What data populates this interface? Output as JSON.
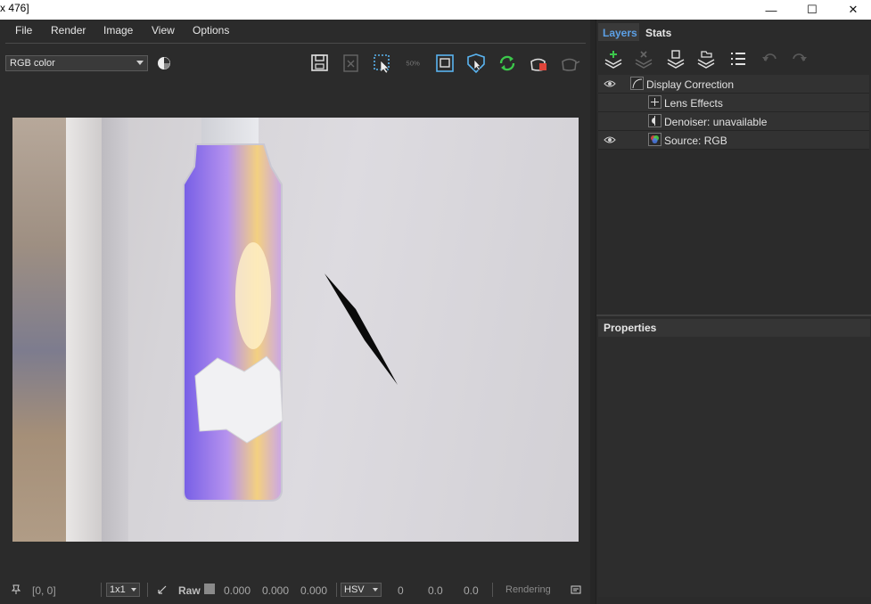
{
  "window": {
    "title_fragment": "x 476]",
    "controls": {
      "minimize": "—",
      "maximize": "☐",
      "close": "✕"
    }
  },
  "menu": [
    "File",
    "Render",
    "Image",
    "View",
    "Options"
  ],
  "toolbar": {
    "channel_select": "RGB color",
    "zoom_label": "50%",
    "icons": [
      "save-icon",
      "clear-icon",
      "region-select-icon",
      "zoom-icon",
      "region-render-icon",
      "track-mouse-icon",
      "refresh-icon",
      "render-last-icon",
      "teapot-icon"
    ]
  },
  "status": {
    "coords": "[0, 0]",
    "sampling": "1x1",
    "raw_label": "Raw",
    "rgb_values": [
      "0.000",
      "0.000",
      "0.000"
    ],
    "color_mode": "HSV",
    "hsv_values": [
      "0",
      "0.0",
      "0.0"
    ],
    "state": "Rendering"
  },
  "panel": {
    "tabs": [
      "Layers",
      "Stats"
    ],
    "layers": [
      {
        "label": "Display Correction",
        "visible": true,
        "indent": 0
      },
      {
        "label": "Lens Effects",
        "visible": false,
        "indent": 1
      },
      {
        "label": "Denoiser: unavailable",
        "visible": false,
        "indent": 1
      },
      {
        "label": "Source: RGB",
        "visible": true,
        "indent": 1
      }
    ],
    "properties_title": "Properties"
  },
  "colors": {
    "accent_tab": "#5ca0e6",
    "refresh_green": "#3cc84b",
    "region_blue": "#5ab4f0"
  }
}
